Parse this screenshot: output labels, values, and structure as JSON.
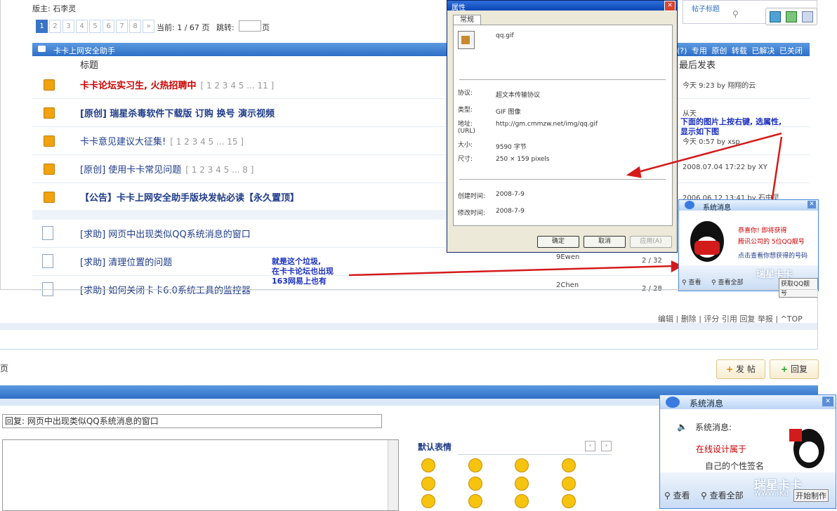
{
  "forum": {
    "moderator": "版主: 石李灵",
    "pager": {
      "pages": [
        "1",
        "2",
        "3",
        "4",
        "5",
        "6",
        "7",
        "8",
        "»"
      ],
      "current_label": "当前: 1 / 67 页",
      "jump_label": "跳转:",
      "jump_suffix": "页"
    },
    "section_title": "卡卡上网安全助手",
    "section_actions": "(?) 专用 原创 转载 已解决 已关闭",
    "col_title": "标题",
    "col_last": "最后发表",
    "threads": [
      {
        "title": "卡卡论坛实习生, 火热招聘中",
        "pages": "[ 1 2 3 4 5 ... 11 ]",
        "style": "red",
        "last": "今天 9:23 by 翔翔的云"
      },
      {
        "title": "[原创] 瑞星杀毒软件下载版 订购 换号 演示视频",
        "pages": "",
        "style": "bluebold",
        "last": "从天"
      },
      {
        "title": "卡卡意见建议大征集!",
        "pages": "[ 1 2 3 4 5 ... 15 ]",
        "style": "blue",
        "last": "今天 0:57 by xsp"
      },
      {
        "title": "[原创] 使用卡卡常见问题",
        "pages": "[ 1 2 3 4 5 ... 8 ]",
        "style": "blue",
        "last": "2008.07.04 17:22 by XY"
      },
      {
        "title": "【公告】卡卡上网安全助手版块发帖必读【永久置顶】",
        "pages": "",
        "style": "bluebold",
        "last": "2006.06.12 13:41 by 石中灵"
      },
      {
        "title": "[求助] 网页中出现类似QQ系统消息的窗口",
        "pages": "",
        "style": "blue",
        "last": ""
      },
      {
        "title": "[求助] 清理位置的问题",
        "pages": "",
        "style": "blue",
        "last": "9Ewen",
        "count": "2 / 32"
      },
      {
        "title": "[求助] 如何关闭卡卡6.0系统工具的监控器",
        "pages": "",
        "style": "blue",
        "last": "2Chen",
        "count": "2 / 28"
      }
    ],
    "annotation_left": [
      "就是这个垃圾,",
      "在卡卡论坛也出现",
      "163网易上也有"
    ],
    "annotation_right": [
      "下面的图片上按右键, 选属性,",
      "显示如下图"
    ]
  },
  "dialog": {
    "title": "属性",
    "tab": "常规",
    "filename": "qq.gif",
    "rows": [
      {
        "k": "协议:",
        "v": "超文本传输协议"
      },
      {
        "k": "类型:",
        "v": "GIF 图像"
      },
      {
        "k": "地址:\n(URL)",
        "v": "http://gm.cmmzw.net/img/qq.gif"
      },
      {
        "k": "大小:",
        "v": "9590 字节"
      },
      {
        "k": "尺寸:",
        "v": "250 × 159 pixels"
      }
    ],
    "created": {
      "k": "创建时间:",
      "v": "2008-7-9"
    },
    "modified": {
      "k": "修改时间:",
      "v": "2008-7-9"
    },
    "ok": "确定",
    "cancel": "取消",
    "apply": "应用(A)"
  },
  "topright": {
    "label": "帖子标题"
  },
  "qq_small": {
    "title": "系统消息",
    "lines": [
      "恭喜你! 即将获得",
      "腾讯公司的 5位QQ靓号",
      "点击查看你想获得的号码"
    ],
    "view": "查看",
    "view_all": "查看全部",
    "brand": "瑞星卡卡",
    "get": "获取QQ靓号"
  },
  "post_actions": "编辑 | 删除 | 评分 引用 回复 举报 | ^TOP",
  "page_suffix": "页",
  "buttons": {
    "new_post": "发 帖",
    "reply": "回复"
  },
  "reply": {
    "field_value": "回复: 网页中出现类似QQ系统消息的窗口",
    "emoji_title": "默认表情"
  },
  "qq_big": {
    "title": "系统消息",
    "label": "系统消息:",
    "line1": "在线设计属于",
    "line2": "自己的个性签名",
    "view": "查看",
    "view_all": "查看全部",
    "brand": "瑞星卡卡",
    "url": "www.ika",
    "start": "开始制作"
  }
}
